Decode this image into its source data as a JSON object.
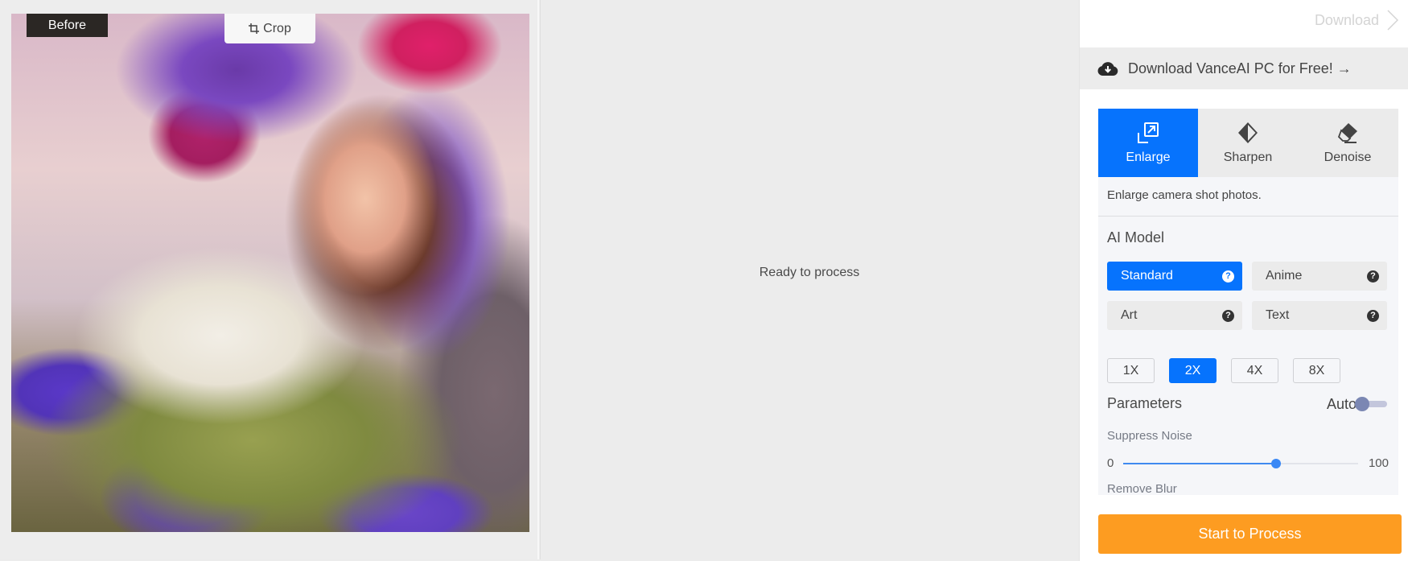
{
  "left_panel": {
    "before_label": "Before",
    "crop_label": "Crop",
    "photo_alt": "Portrait painting of a woman with a purple and pink flower crown in a field of violet flowers"
  },
  "middle_panel": {
    "status": "Ready to process"
  },
  "right_panel": {
    "download_label": "Download",
    "promo_text": "Download VanceAI PC for Free! →",
    "tabs": [
      {
        "label": "Enlarge",
        "icon": "enlarge-icon",
        "active": true
      },
      {
        "label": "Sharpen",
        "icon": "sharpen-icon",
        "active": false
      },
      {
        "label": "Denoise",
        "icon": "eraser-icon",
        "active": false
      }
    ],
    "description": "Enlarge camera shot photos.",
    "ai_model": {
      "title": "AI Model",
      "options": [
        {
          "label": "Standard",
          "active": true
        },
        {
          "label": "Anime",
          "active": false
        },
        {
          "label": "Art",
          "active": false
        },
        {
          "label": "Text",
          "active": false
        }
      ],
      "help_glyph": "?"
    },
    "scales": [
      {
        "label": "1X",
        "active": false
      },
      {
        "label": "2X",
        "active": true
      },
      {
        "label": "4X",
        "active": false
      },
      {
        "label": "8X",
        "active": false
      }
    ],
    "parameters": {
      "title": "Parameters",
      "auto_label": "Auto",
      "auto_enabled": false,
      "suppress_noise": {
        "label": "Suppress Noise",
        "min": "0",
        "max": "100",
        "value": 65
      },
      "remove_blur": {
        "label": "Remove Blur"
      }
    },
    "start_button": "Start to Process"
  },
  "colors": {
    "accent_blue": "#0673fd",
    "start_orange": "#fd9c21"
  }
}
